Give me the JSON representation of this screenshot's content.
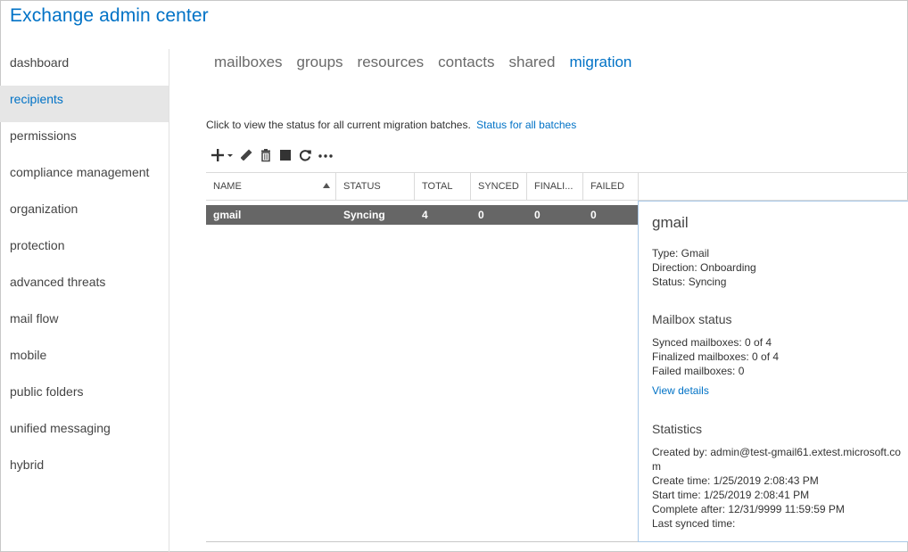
{
  "app": {
    "title": "Exchange admin center"
  },
  "sidebar": {
    "items": [
      {
        "label": "dashboard"
      },
      {
        "label": "recipients"
      },
      {
        "label": "permissions"
      },
      {
        "label": "compliance management"
      },
      {
        "label": "organization"
      },
      {
        "label": "protection"
      },
      {
        "label": "advanced threats"
      },
      {
        "label": "mail flow"
      },
      {
        "label": "mobile"
      },
      {
        "label": "public folders"
      },
      {
        "label": "unified messaging"
      },
      {
        "label": "hybrid"
      }
    ],
    "active_index": 1
  },
  "tabs": [
    {
      "label": "mailboxes"
    },
    {
      "label": "groups"
    },
    {
      "label": "resources"
    },
    {
      "label": "contacts"
    },
    {
      "label": "shared"
    },
    {
      "label": "migration"
    }
  ],
  "info": {
    "text": "Click to view the status for all current migration batches.",
    "link": "Status for all batches"
  },
  "toolbar": {
    "icons": [
      "add-icon",
      "dropdown-arrow-icon",
      "edit-icon",
      "delete-icon",
      "stop-icon",
      "refresh-icon",
      "more-icon"
    ]
  },
  "grid": {
    "columns": [
      "NAME",
      "STATUS",
      "TOTAL",
      "SYNCED",
      "FINALI...",
      "FAILED"
    ],
    "rows": [
      {
        "name": "gmail",
        "status": "Syncing",
        "total": "4",
        "synced": "0",
        "finalized": "0",
        "failed": "0"
      }
    ]
  },
  "details": {
    "title": "gmail",
    "type": "Type: Gmail",
    "direction": "Direction: Onboarding",
    "status": "Status: Syncing",
    "mailbox_status_title": "Mailbox status",
    "synced_mailboxes": "Synced mailboxes: 0 of 4",
    "finalized_mailboxes": "Finalized mailboxes: 0 of 4",
    "failed_mailboxes": "Failed mailboxes: 0",
    "view_details": "View details",
    "statistics_title": "Statistics",
    "created_by": "Created by: admin@test-gmail61.extest.microsoft.com",
    "create_time": "Create time: 1/25/2019 2:08:43 PM",
    "start_time": "Start time: 1/25/2019 2:08:41 PM",
    "complete_after": "Complete after: 12/31/9999 11:59:59 PM",
    "last_synced": "Last synced time:"
  },
  "colors": {
    "accent": "#0072c6",
    "selected_row": "#666666",
    "sidebar_active_bg": "#e6e6e6"
  }
}
